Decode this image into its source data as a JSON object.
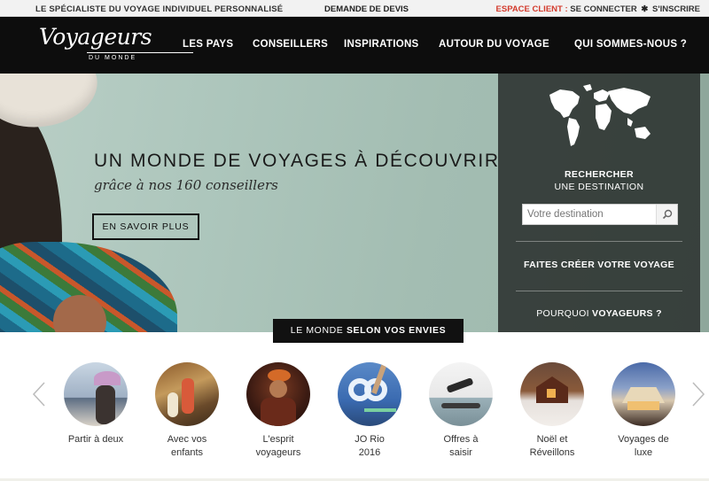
{
  "topbar": {
    "tagline": "LE SPÉCIALISTE DU VOYAGE INDIVIDUEL PERSONNALISÉ",
    "devis": "DEMANDE DE DEVIS",
    "client_label": "ESPACE CLIENT :",
    "connect": "SE CONNECTER",
    "separator": "✱",
    "register": "S'INSCRIRE"
  },
  "logo": {
    "main": "Voyageurs",
    "sub": "DU MONDE"
  },
  "nav": [
    {
      "label": "LES PAYS"
    },
    {
      "label": "CONSEILLERS"
    },
    {
      "label": "INSPIRATIONS"
    },
    {
      "label": "AUTOUR DU VOYAGE"
    },
    {
      "label": "QUI SOMMES-NOUS ?"
    }
  ],
  "hero": {
    "title": "UN MONDE DE VOYAGES À DÉCOUVRIR",
    "subtitle": "grâce à nos 160 conseillers",
    "button": "EN SAVOIR PLUS"
  },
  "search_panel": {
    "title": "RECHERCHER",
    "subtitle": "UNE DESTINATION",
    "placeholder": "Votre destination",
    "cta_create": "FAITES CRÉER VOTRE VOYAGE",
    "cta_why_prefix": "POURQUOI ",
    "cta_why_bold": "VOYAGEURS ?"
  },
  "ribbon": {
    "prefix": "LE MONDE ",
    "bold": "SELON VOS ENVIES"
  },
  "carousel": {
    "items": [
      {
        "line1": "Partir à deux",
        "line2": ""
      },
      {
        "line1": "Avec vos",
        "line2": "enfants"
      },
      {
        "line1": "L'esprit",
        "line2": "voyageurs"
      },
      {
        "line1": "JO Rio",
        "line2": "2016"
      },
      {
        "line1": "Offres à",
        "line2": "saisir"
      },
      {
        "line1": "Noël et",
        "line2": "Réveillons"
      },
      {
        "line1": "Voyages de",
        "line2": "luxe"
      }
    ]
  },
  "colors": {
    "accent_red": "#d33a2c",
    "header_bg": "#0d0d0d",
    "panel_bg": "#2a302d"
  }
}
